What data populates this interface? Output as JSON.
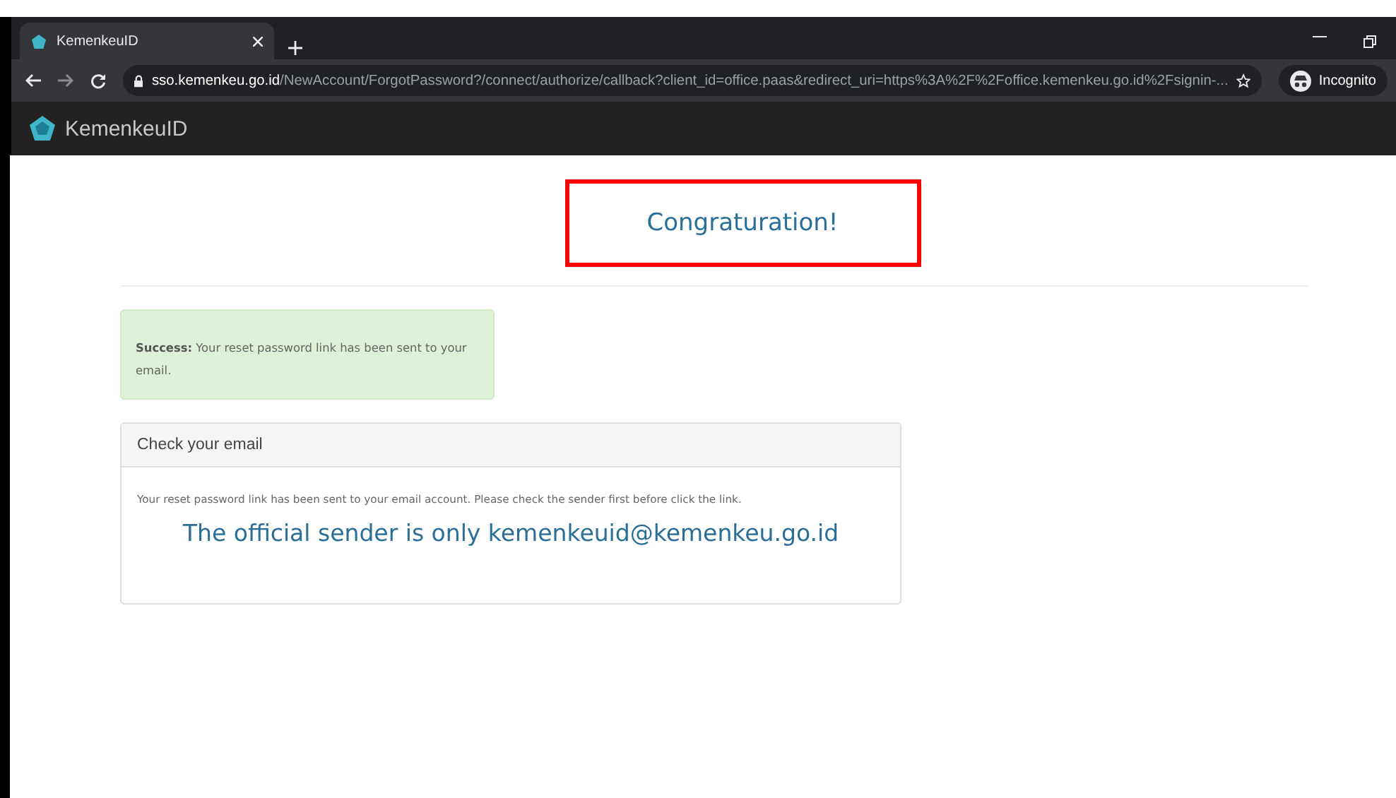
{
  "browser": {
    "tabs": [
      {
        "title": "KemenkeuID",
        "selected": true
      }
    ],
    "address": {
      "host": "sso.kemenkeu.go.id",
      "path": "/NewAccount/ForgotPassword?/connect/authorize/callback?client_id=office.paas&redirect_uri=https%3A%2F%2Foffice.kemenkeu.go.id%2Fsignin-..."
    },
    "profile": "Incognito"
  },
  "navbar": {
    "brand": "KemenkeuID"
  },
  "page": {
    "heading": "Congraturation!",
    "alert": {
      "label": "Success:",
      "text": "Your reset password link has been sent to your email."
    },
    "card": {
      "header": "Check your email",
      "body": "Your reset password link has been sent to your email account. Please check the sender first before click the link.",
      "sender": "The official sender is only kemenkeuid@kemenkeu.go.id"
    }
  }
}
